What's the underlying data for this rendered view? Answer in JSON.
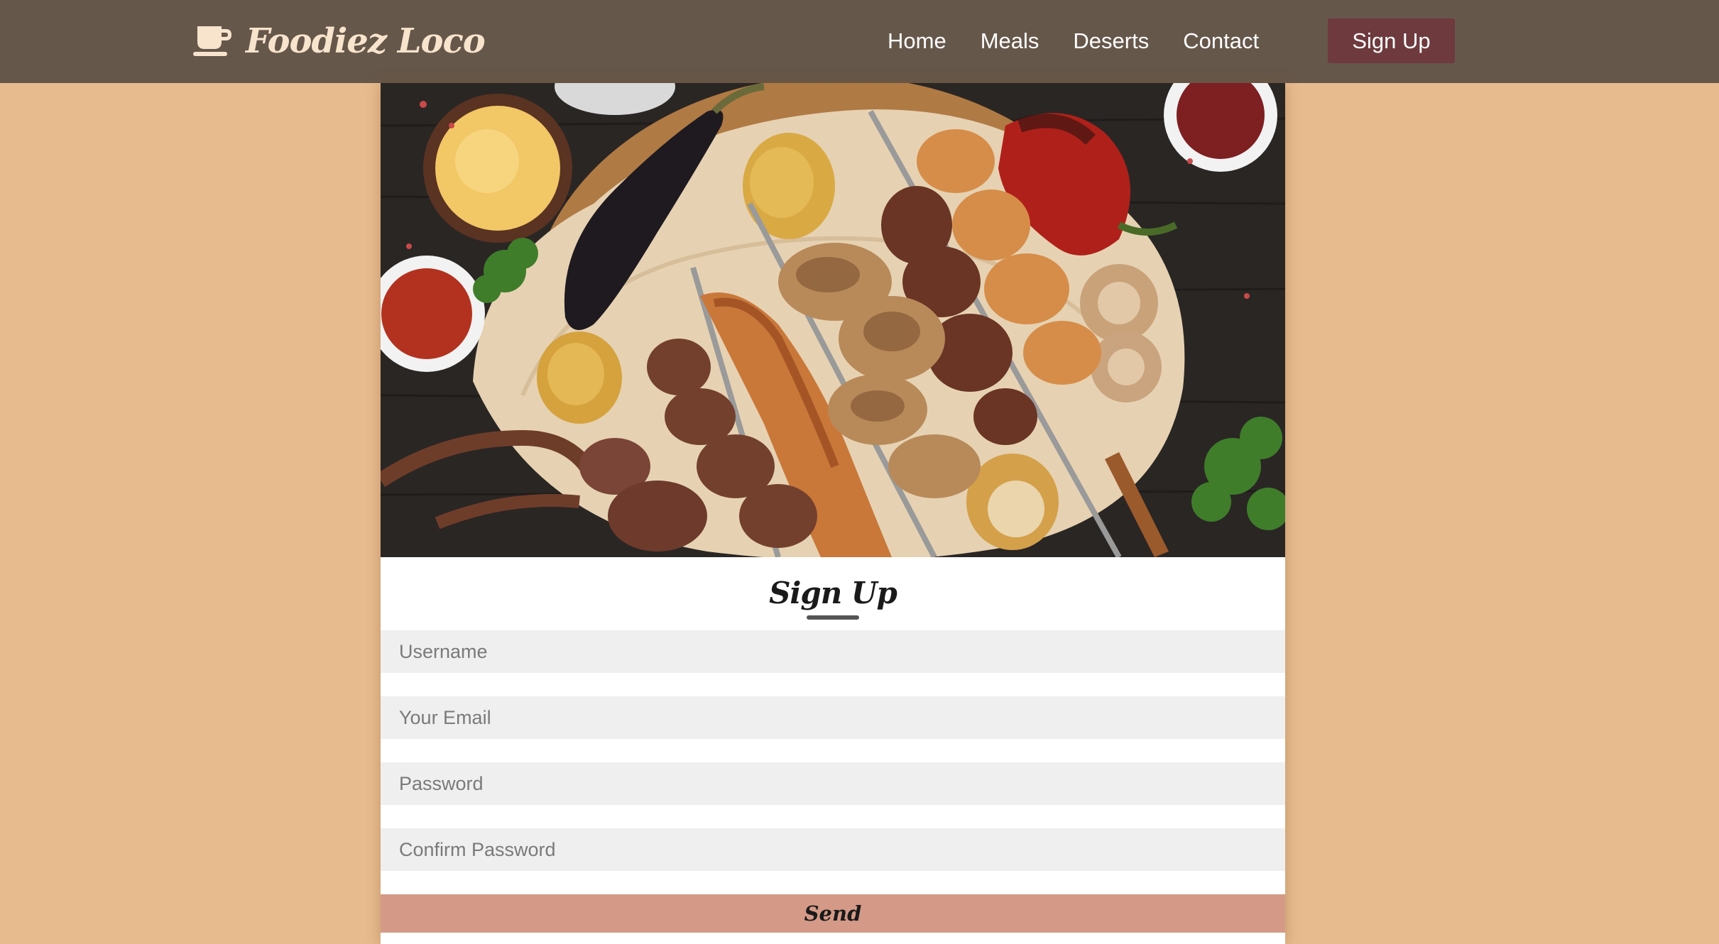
{
  "navbar": {
    "brand_name": "Foodiez Loco",
    "brand_icon": "coffee-cup-icon",
    "links": [
      {
        "label": "Home"
      },
      {
        "label": "Meals"
      },
      {
        "label": "Deserts"
      },
      {
        "label": "Contact"
      }
    ],
    "signup_label": "Sign Up"
  },
  "form": {
    "title": "Sign Up",
    "fields": [
      {
        "placeholder": "Username"
      },
      {
        "placeholder": "Your Email"
      },
      {
        "placeholder": "Password"
      },
      {
        "placeholder": "Confirm Password"
      }
    ],
    "submit_label": "Send"
  },
  "colors": {
    "page_background": "#e8bb8e",
    "navbar_background": "#66574b",
    "signup_button": "#6e3a3e",
    "send_button": "#d49a87",
    "input_background": "#efefef"
  }
}
